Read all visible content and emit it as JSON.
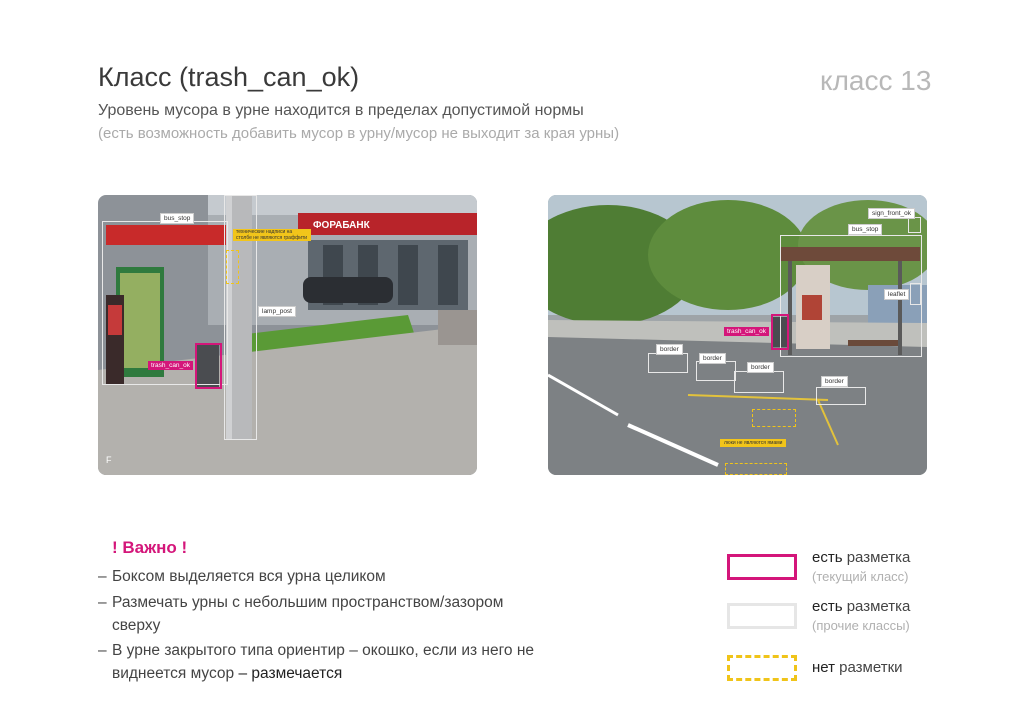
{
  "header": {
    "title": "Класс (trash_can_ok)",
    "slide_number": "класс 13",
    "subtitle": "Уровень мусора в урне находится в пределах допустимой нормы",
    "subnote": "(есть возможность добавить мусор в урну/мусор не выходит за края урны)"
  },
  "photo_left": {
    "labels": {
      "bus_stop": "bus_stop",
      "lamp_post": "lamp_post",
      "trash_can_ok": "trash_can_ok",
      "note": "технические надписи на столбе не являются граффити",
      "bank_sign": "ФОРАБАНК"
    }
  },
  "photo_right": {
    "labels": {
      "sign_front_ok": "sign_front_ok",
      "bus_stop": "bus_stop",
      "leaflet": "leaflet",
      "trash_can_ok": "trash_can_ok",
      "border_1": "border",
      "border_2": "border",
      "border_3": "border",
      "border_4": "border",
      "note": "люки не являются ямами"
    }
  },
  "important": {
    "heading": "! Важно !",
    "bullets": [
      {
        "dash": "–",
        "text": "Боксом выделяется вся урна целиком"
      },
      {
        "dash": "–",
        "text": "Размечать урны с небольшим пространством/зазором сверху"
      },
      {
        "dash": "–",
        "text": "В урне закрытого типа ориентир – окошко, если из него не виднеется мусор",
        "strong_dash": " – ",
        "strong": "размечается"
      }
    ]
  },
  "legend": {
    "items": [
      {
        "bold": "есть",
        "label": " разметка",
        "sub": "(текущий класс)",
        "color": "#d4167a"
      },
      {
        "bold": "есть",
        "label": " разметка",
        "sub": "(прочие классы)",
        "color": "#e6e6e6"
      },
      {
        "bold": "нет",
        "label": " разметки",
        "sub": "",
        "color": "#f0c419"
      }
    ]
  }
}
